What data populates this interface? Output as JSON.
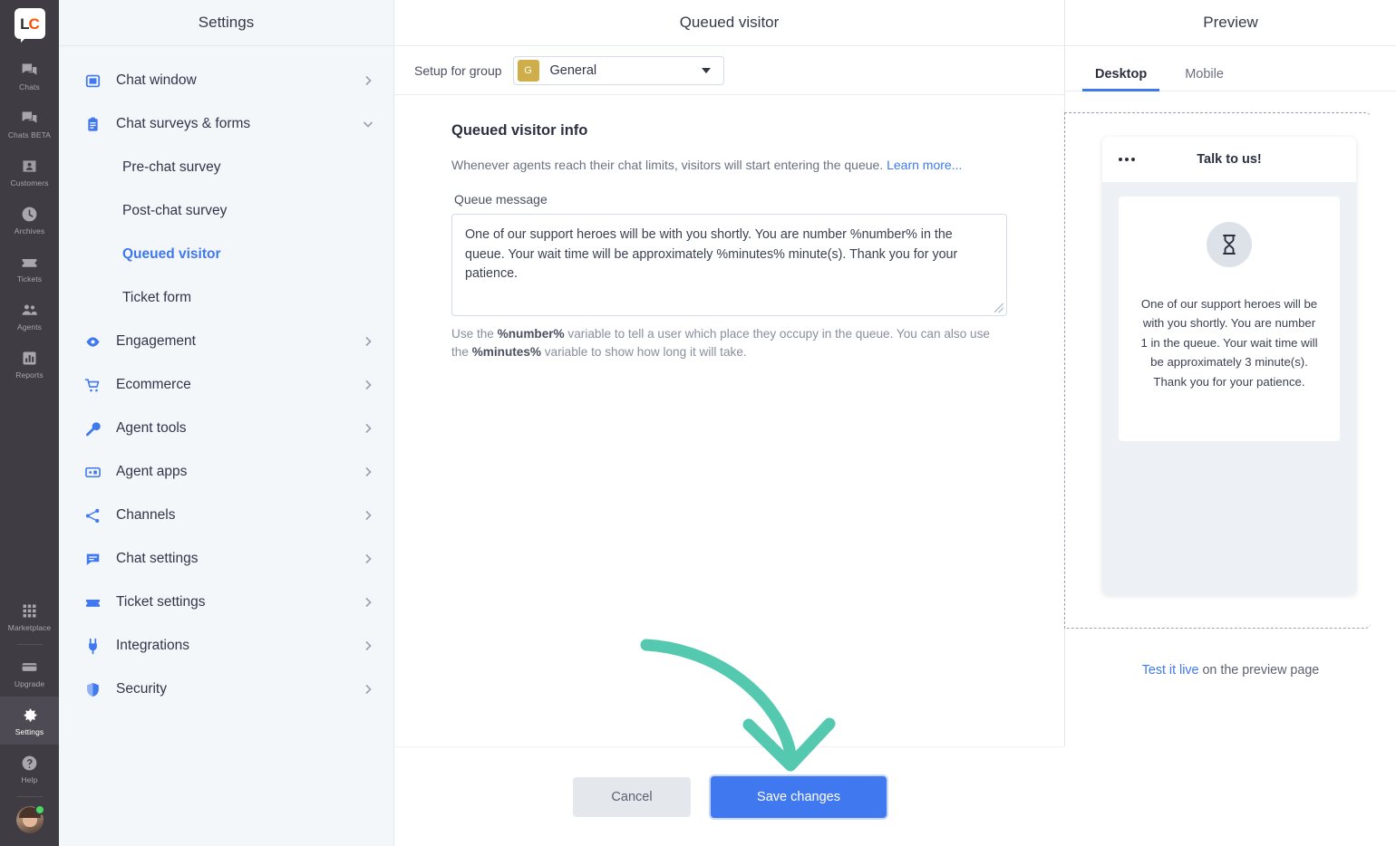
{
  "rail": {
    "logo": {
      "left": "L",
      "right": "C"
    },
    "items": [
      {
        "label": "Chats",
        "icon": "chat-icon",
        "active": false
      },
      {
        "label": "Chats BETA",
        "icon": "chat-beta-icon",
        "active": false
      },
      {
        "label": "Customers",
        "icon": "customers-icon",
        "active": false
      },
      {
        "label": "Archives",
        "icon": "clock-icon",
        "active": false
      },
      {
        "label": "Tickets",
        "icon": "ticket-icon",
        "active": false
      },
      {
        "label": "Agents",
        "icon": "agents-icon",
        "active": false
      },
      {
        "label": "Reports",
        "icon": "reports-icon",
        "active": false
      },
      {
        "label": "Marketplace",
        "icon": "grid-icon",
        "active": false
      },
      {
        "label": "Upgrade",
        "icon": "upgrade-icon",
        "active": false
      },
      {
        "label": "Settings",
        "icon": "gear-icon",
        "active": true
      },
      {
        "label": "Help",
        "icon": "question-icon",
        "active": false
      }
    ]
  },
  "settings": {
    "title": "Settings",
    "nav": [
      {
        "label": "Chat window",
        "icon": "window-icon",
        "chevron": "right",
        "type": "parent"
      },
      {
        "label": "Chat surveys & forms",
        "icon": "clipboard-icon",
        "chevron": "down",
        "type": "parent"
      },
      {
        "label": "Pre-chat survey",
        "type": "child",
        "active": false
      },
      {
        "label": "Post-chat survey",
        "type": "child",
        "active": false
      },
      {
        "label": "Queued visitor",
        "type": "child",
        "active": true
      },
      {
        "label": "Ticket form",
        "type": "child",
        "active": false
      },
      {
        "label": "Engagement",
        "icon": "eye-icon",
        "chevron": "right",
        "type": "parent"
      },
      {
        "label": "Ecommerce",
        "icon": "cart-icon",
        "chevron": "right",
        "type": "parent"
      },
      {
        "label": "Agent tools",
        "icon": "wrench-icon",
        "chevron": "right",
        "type": "parent"
      },
      {
        "label": "Agent apps",
        "icon": "apps-icon",
        "chevron": "right",
        "type": "parent"
      },
      {
        "label": "Channels",
        "icon": "channels-icon",
        "chevron": "right",
        "type": "parent"
      },
      {
        "label": "Chat settings",
        "icon": "speech-icon",
        "chevron": "right",
        "type": "parent"
      },
      {
        "label": "Ticket settings",
        "icon": "ticket-icon",
        "chevron": "right",
        "type": "parent"
      },
      {
        "label": "Integrations",
        "icon": "plug-icon",
        "chevron": "right",
        "type": "parent"
      },
      {
        "label": "Security",
        "icon": "shield-icon",
        "chevron": "right",
        "type": "parent"
      }
    ]
  },
  "main": {
    "title": "Queued visitor",
    "group_label": "Setup for group",
    "group_badge": "G",
    "group_value": "General",
    "section_title": "Queued visitor info",
    "section_desc": "Whenever agents reach their chat limits, visitors will start entering the queue.",
    "learn_more": "Learn more...",
    "field_label": "Queue message",
    "queue_message": "One of our support heroes will be with you shortly. You are number %number% in the queue. Your wait time will be approximately %minutes% minute(s). Thank you for your patience.",
    "hint_1": "Use the ",
    "hint_var_1": "%number%",
    "hint_2": " variable to tell a user which place they occupy in the queue. You can also use the ",
    "hint_var_2": "%minutes%",
    "hint_3": " variable to show how long it will take."
  },
  "preview": {
    "title": "Preview",
    "tabs": [
      {
        "label": "Desktop",
        "active": true
      },
      {
        "label": "Mobile",
        "active": false
      }
    ],
    "widget_title": "Talk to us!",
    "widget_icon": "hourglass-icon",
    "widget_message": "One of our support heroes will be with you shortly. You are number 1 in the queue. Your wait time will be approximately 3 minute(s). Thank you for your patience.",
    "test_link": "Test it live",
    "test_suffix": " on the preview page"
  },
  "footer": {
    "cancel": "Cancel",
    "save": "Save changes"
  },
  "colors": {
    "accent": "#3f78ef",
    "rail_bg": "#3f3c43",
    "panel_bg": "#f4f7fa",
    "arrow": "#54c9af",
    "group_badge": "#cfae49"
  }
}
